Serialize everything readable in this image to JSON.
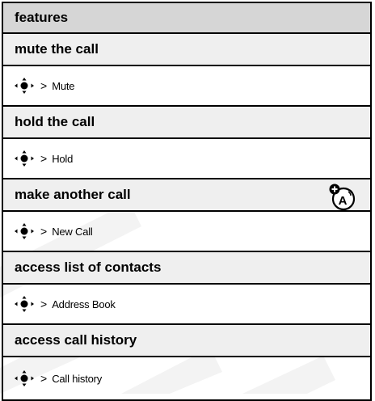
{
  "table": {
    "header": "features",
    "features": [
      {
        "title": "mute the call",
        "menu_item": "Mute",
        "icon": "nav-key-icon",
        "separator": ">"
      },
      {
        "title": "hold the call",
        "menu_item": "Hold",
        "icon": "nav-key-icon",
        "separator": ">"
      },
      {
        "title": "make another call",
        "menu_item": "New Call",
        "icon": "nav-key-icon",
        "separator": ">",
        "extra_icon": "network-dependent-feature-icon"
      },
      {
        "title": "access list of contacts",
        "menu_item": "Address Book",
        "icon": "nav-key-icon",
        "separator": ">"
      },
      {
        "title": "access call history",
        "menu_item": "Call history",
        "icon": "nav-key-icon",
        "separator": ">"
      }
    ]
  },
  "colors": {
    "header_bg": "#d6d6d6",
    "title_bg": "#efefef",
    "border": "#000000",
    "watermark": "#f2f2f2"
  }
}
